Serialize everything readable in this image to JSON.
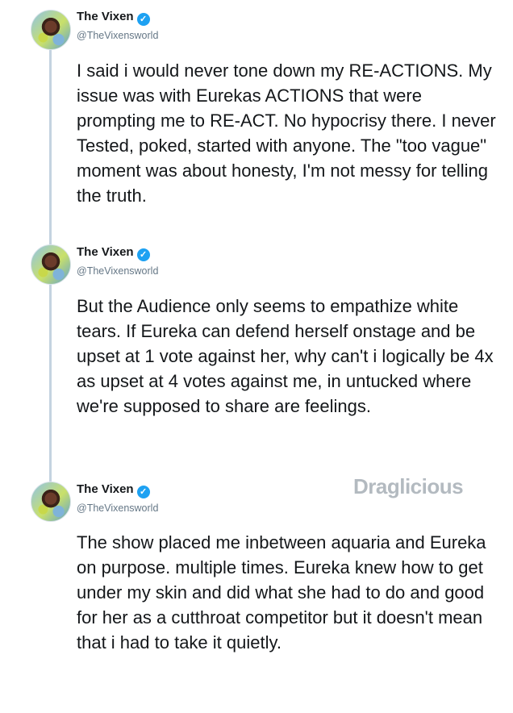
{
  "tweets": [
    {
      "name": "The Vixen",
      "handle": "@TheVixensworld",
      "text": "I said i would never tone down my RE-ACTIONS. My issue was with Eurekas ACTIONS that were prompting me to RE-ACT. No hypocrisy there. I never Tested, poked, started with anyone. The \"too vague\" moment was about honesty, I'm not messy for telling the truth."
    },
    {
      "name": "The Vixen",
      "handle": "@TheVixensworld",
      "text": "But the Audience only seems to empathize white tears. If Eureka can defend herself onstage and be upset at 1 vote against her, why can't i logically be 4x as upset at 4 votes against me, in untucked where we're supposed to share are feelings."
    },
    {
      "name": "The Vixen",
      "handle": "@TheVixensworld",
      "text": "The show placed me inbetween aquaria and Eureka on purpose. multiple times. Eureka knew how to get under my skin and did what she had to do and good for her as a cutthroat competitor but it doesn't mean that i had to take it quietly."
    }
  ],
  "watermark": "Draglicious",
  "colors": {
    "verified": "#1da1f2",
    "thread_line": "#c4d3e0",
    "handle": "#657786"
  }
}
